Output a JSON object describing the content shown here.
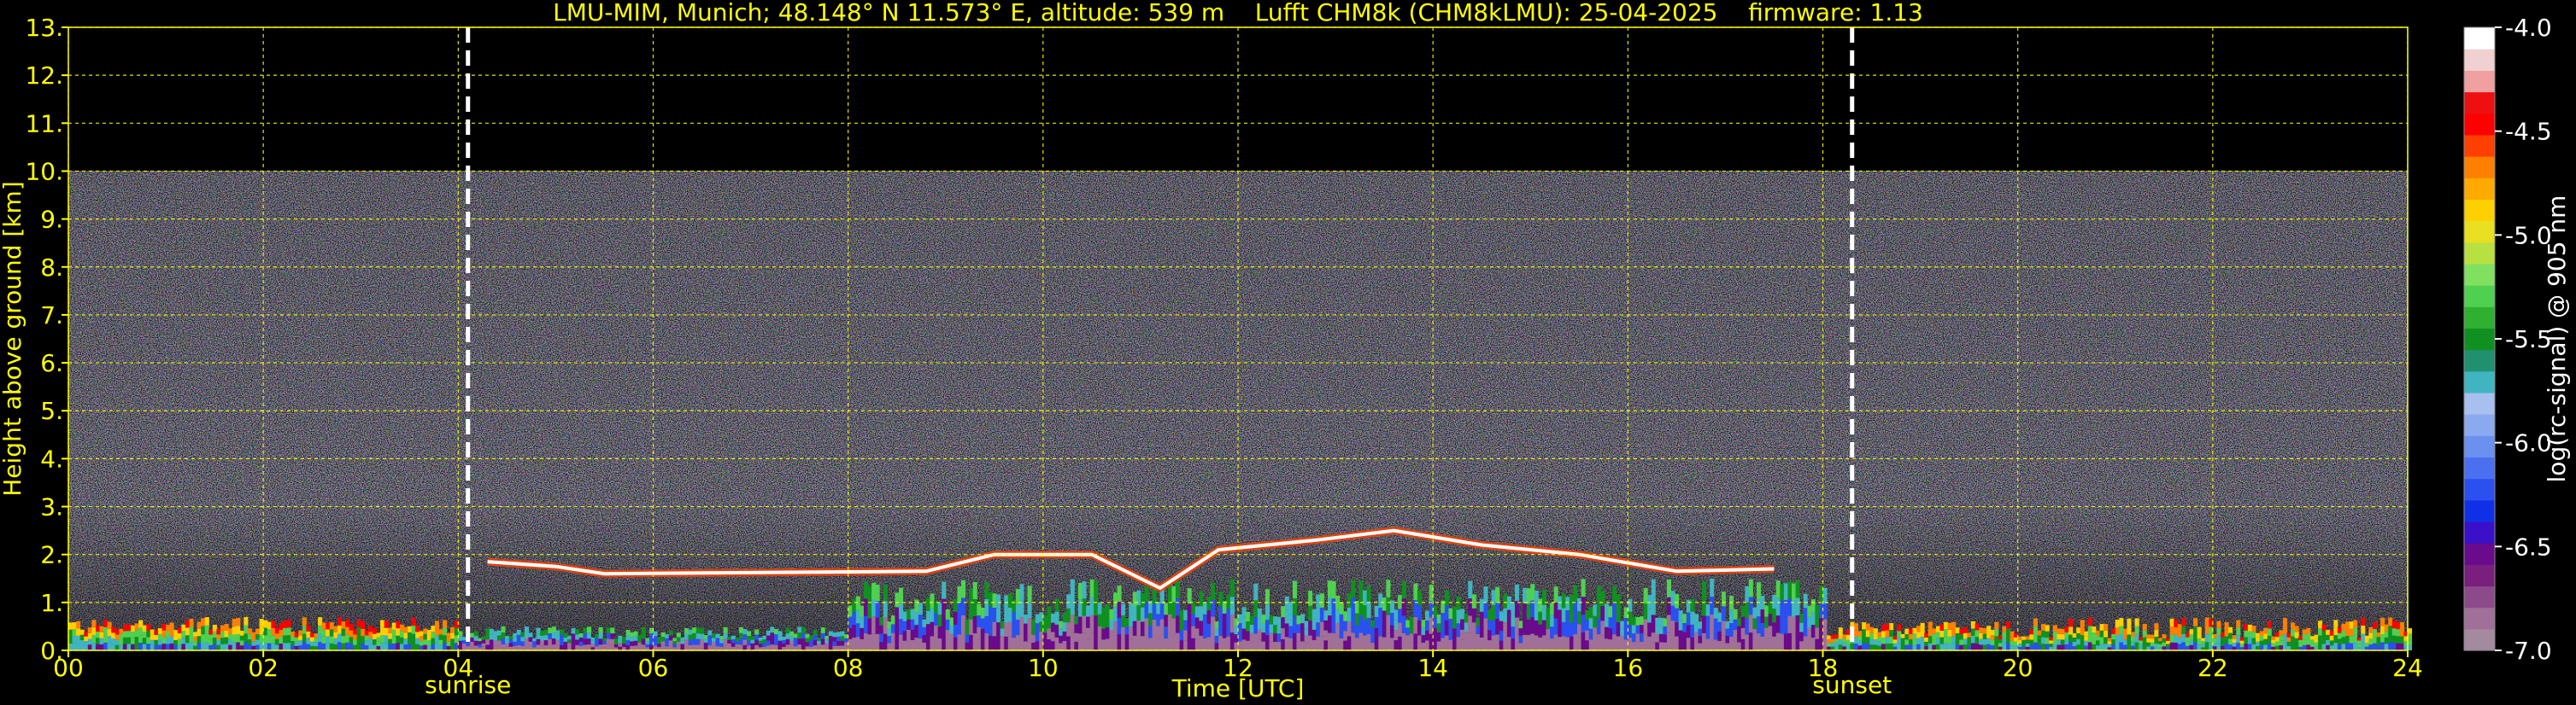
{
  "chart_data": {
    "type": "heatmap",
    "title": "LMU-MIM, Munich; 48.148° N 11.573° E, altitude: 539 m    Lufft CHM8k (CHM8kLMU): 25-04-2025    firmware: 1.13",
    "xlabel": "Time [UTC]",
    "ylabel": "Height above ground [km]",
    "xlim": [
      0,
      24
    ],
    "ylim": [
      0,
      13
    ],
    "x_ticks": [
      0,
      2,
      4,
      6,
      8,
      10,
      12,
      14,
      16,
      18,
      20,
      22,
      24
    ],
    "x_tick_labels": [
      "00",
      "02",
      "04",
      "06",
      "08",
      "10",
      "12",
      "14",
      "16",
      "18",
      "20",
      "22",
      "24"
    ],
    "y_ticks": [
      0,
      1,
      2,
      3,
      4,
      5,
      6,
      7,
      8,
      9,
      10,
      11,
      12,
      13
    ],
    "y_tick_labels": [
      "0.",
      "1.",
      "2.",
      "3.",
      "4.",
      "5.",
      "6.",
      "7.",
      "8.",
      "9.",
      "10.",
      "11.",
      "12.",
      "13."
    ],
    "grid": true,
    "signal_top_km": 10,
    "sun_events": [
      {
        "label": "sunrise",
        "time": 4.1
      },
      {
        "label": "sunset",
        "time": 18.3
      }
    ],
    "cloud_base_km": [
      {
        "t": 4.3,
        "h": 1.85
      },
      {
        "t": 5.0,
        "h": 1.75
      },
      {
        "t": 5.5,
        "h": 1.6
      },
      {
        "t": 8.8,
        "h": 1.65
      },
      {
        "t": 9.5,
        "h": 2.0
      },
      {
        "t": 10.5,
        "h": 2.0
      },
      {
        "t": 11.2,
        "h": 1.3
      },
      {
        "t": 11.8,
        "h": 2.1
      },
      {
        "t": 12.8,
        "h": 2.3
      },
      {
        "t": 13.6,
        "h": 2.5
      },
      {
        "t": 14.5,
        "h": 2.2
      },
      {
        "t": 15.5,
        "h": 2.0
      },
      {
        "t": 16.5,
        "h": 1.65
      },
      {
        "t": 17.5,
        "h": 1.7
      }
    ],
    "colorbar": {
      "label": "log(rc-signal) @ 905 nm",
      "range": [
        -7.0,
        -4.0
      ],
      "tick_labels": [
        "-4.0",
        "-4.5",
        "-5.0",
        "-5.5",
        "-6.0",
        "-6.5",
        "-7.0"
      ],
      "colors": [
        "#a48a9e",
        "#a07098",
        "#8c4a8a",
        "#7a1f7e",
        "#6a0a8c",
        "#3a10c8",
        "#1030e8",
        "#2a50f0",
        "#4a70f0",
        "#6a90f0",
        "#8aaaf0",
        "#a8c0f0",
        "#40b4c0",
        "#209070",
        "#109020",
        "#30b030",
        "#50d050",
        "#80e060",
        "#b8e040",
        "#e8e020",
        "#ffd000",
        "#ffaa00",
        "#ff8000",
        "#ff4000",
        "#ff0000",
        "#ee1010",
        "#f0a0a0",
        "#f0d0d0",
        "#ffffff"
      ]
    },
    "axis_text_color": "#ffff00",
    "grid_color": "#ffff00",
    "background": "#000000"
  }
}
